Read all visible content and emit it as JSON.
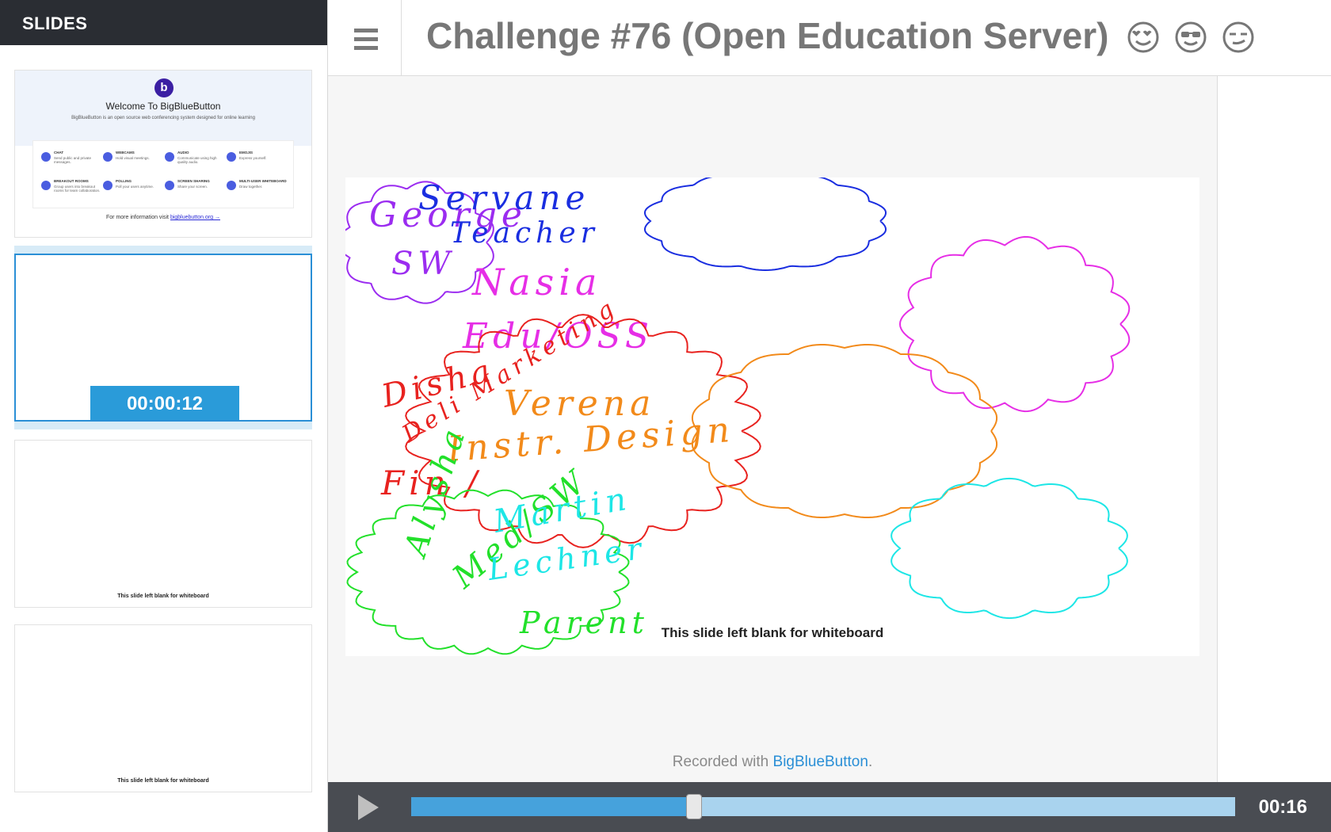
{
  "sidebar": {
    "title": "SLIDES",
    "thumbnails": [
      {
        "kind": "welcome",
        "title": "Welcome To BigBlueButton",
        "subtitle": "BigBlueButton is an open source web conferencing system designed for online learning",
        "logo_letter": "b",
        "features": [
          {
            "name": "CHAT",
            "desc": "Send public and private messages."
          },
          {
            "name": "WEBCAMS",
            "desc": "Hold visual meetings."
          },
          {
            "name": "AUDIO",
            "desc": "Communicate using high quality audio."
          },
          {
            "name": "EMOJIS",
            "desc": "Express yourself."
          },
          {
            "name": "BREAKOUT ROOMS",
            "desc": "Group users into breakout rooms for team collaboration."
          },
          {
            "name": "POLLING",
            "desc": "Poll your users anytime."
          },
          {
            "name": "SCREEN SHARING",
            "desc": "Share your screen."
          },
          {
            "name": "MULTI-USER WHITEBOARD",
            "desc": "Draw together."
          }
        ],
        "footer_text": "For more information visit",
        "footer_link": "bigbluebutton.org →"
      },
      {
        "kind": "active",
        "timer": "00:00:12"
      },
      {
        "kind": "blank",
        "note": "This slide left blank for whiteboard"
      },
      {
        "kind": "blank",
        "note": "This slide left blank for whiteboard"
      }
    ]
  },
  "header": {
    "title": "Challenge #76 (Open Education Server)",
    "emojis": [
      "heart-eyes-emoji",
      "sunglasses-emoji",
      "smirk-emoji"
    ]
  },
  "slide": {
    "note": "This slide left blank for whiteboard",
    "annotations": [
      {
        "color": "#9b2cf0",
        "lines": [
          "George",
          "SW"
        ]
      },
      {
        "color": "#1a2ee0",
        "lines": [
          "Servane",
          "Teacher"
        ]
      },
      {
        "color": "#e62ee6",
        "lines": [
          "Nasia",
          "Edu/OSS"
        ]
      },
      {
        "color": "#e8221f",
        "lines": [
          "Disha",
          "Deli Marketing",
          "Fin /"
        ]
      },
      {
        "color": "#f28a1a",
        "lines": [
          "Verena",
          "Instr. Design"
        ]
      },
      {
        "color": "#22e02a",
        "lines": [
          "Alysha",
          "Med/SW",
          "Parent"
        ]
      },
      {
        "color": "#1de6e6",
        "lines": [
          "Martin",
          "Lechner"
        ]
      }
    ]
  },
  "footer": {
    "recorded_prefix": "Recorded with ",
    "recorded_link": "BigBlueButton",
    "recorded_suffix": "."
  },
  "player": {
    "time": "00:16",
    "progress": 0.343
  }
}
